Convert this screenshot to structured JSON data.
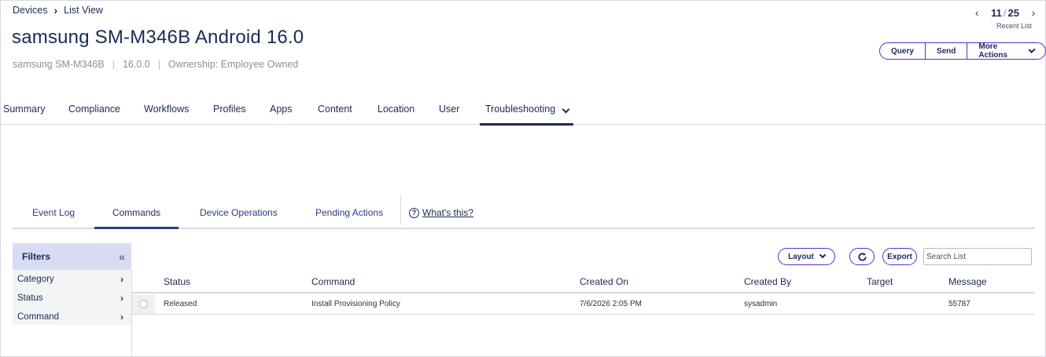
{
  "breadcrumb": {
    "root": "Devices",
    "current": "List View"
  },
  "device": {
    "title": "samsung SM-M346B Android 16.0",
    "model": "samsung SM-M346B",
    "os_version": "16.0.0",
    "ownership": "Ownership: Employee Owned"
  },
  "pager": {
    "current": "11",
    "total": "25",
    "recent_label": "Recent List"
  },
  "actions": {
    "query": "Query",
    "send": "Send",
    "more": "More Actions"
  },
  "tabs": [
    "Summary",
    "Compliance",
    "Workflows",
    "Profiles",
    "Apps",
    "Content",
    "Location",
    "User",
    "Troubleshooting"
  ],
  "subtabs": [
    "Event Log",
    "Commands",
    "Device Operations",
    "Pending Actions"
  ],
  "help_link": "What's this?",
  "filters": {
    "title": "Filters",
    "items": [
      "Category",
      "Status",
      "Command"
    ]
  },
  "toolbar": {
    "layout": "Layout",
    "export": "Export",
    "search_placeholder": "Search List"
  },
  "table": {
    "headers": [
      "Status",
      "Command",
      "Created On",
      "Created By",
      "Target",
      "Message"
    ],
    "rows": [
      {
        "status": "Released",
        "command": "Install Provisioning Policy",
        "created_on": "7/6/2026 2:05 PM",
        "created_by": "sysadmin",
        "target": "",
        "message": "55787"
      }
    ]
  },
  "colors": {
    "accent": "#5b2bd1",
    "navy": "#1b2a55",
    "filters_header": "#d8dcf3"
  }
}
